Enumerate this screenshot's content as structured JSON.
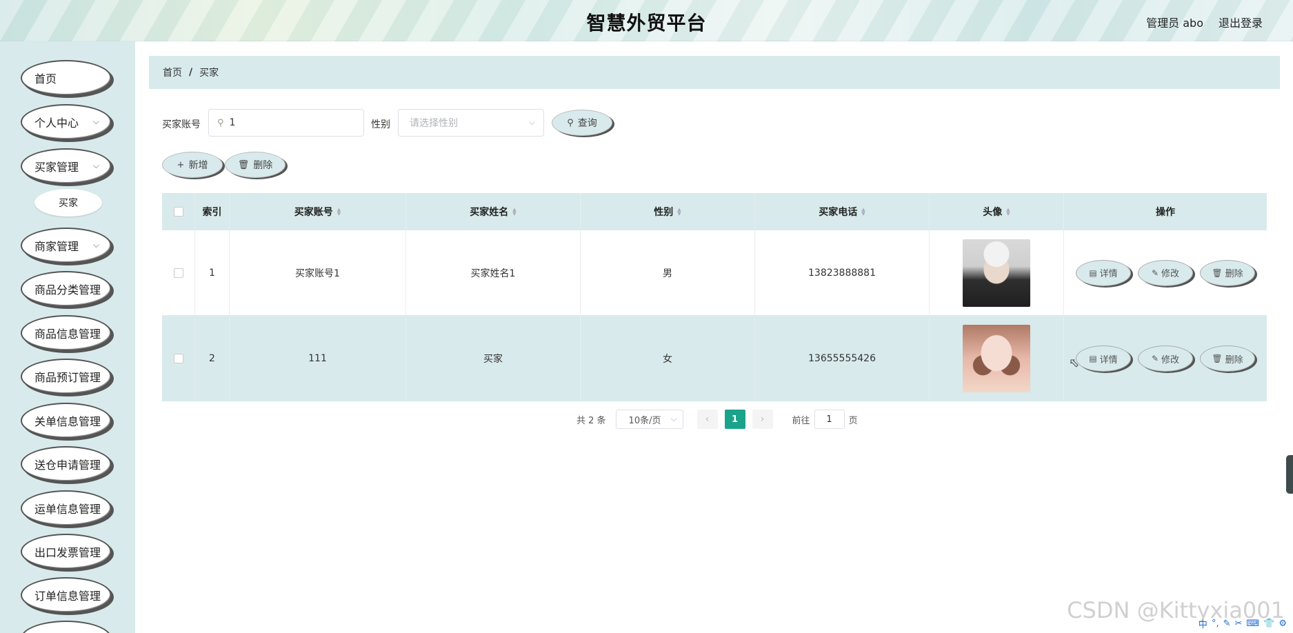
{
  "header": {
    "title": "智慧外贸平台",
    "user": "管理员 abo",
    "logout": "退出登录"
  },
  "sidebar": {
    "items": [
      {
        "label": "首页",
        "chevron": false
      },
      {
        "label": "个人中心",
        "chevron": true
      },
      {
        "label": "买家管理",
        "chevron": true
      },
      {
        "label": "商家管理",
        "chevron": true
      },
      {
        "label": "商品分类管理",
        "chevron": false
      },
      {
        "label": "商品信息管理",
        "chevron": false
      },
      {
        "label": "商品预订管理",
        "chevron": false
      },
      {
        "label": "关单信息管理",
        "chevron": false
      },
      {
        "label": "送仓申请管理",
        "chevron": false
      },
      {
        "label": "运单信息管理",
        "chevron": false
      },
      {
        "label": "出口发票管理",
        "chevron": false
      },
      {
        "label": "订单信息管理",
        "chevron": false
      }
    ],
    "subitem": "买家",
    "chevron_glyph": "⌵"
  },
  "breadcrumb": {
    "home": "首页",
    "separator": "/",
    "current": "买家"
  },
  "search": {
    "account_label": "买家账号",
    "account_value": "1",
    "gender_label": "性别",
    "gender_placeholder": "请选择性别",
    "query_button": "查询"
  },
  "actions": {
    "add": "新增",
    "delete": "删除"
  },
  "table": {
    "columns": [
      "索引",
      "买家账号",
      "买家姓名",
      "性别",
      "买家电话",
      "头像",
      "操作"
    ],
    "rows": [
      {
        "index": "1",
        "account": "买家账号1",
        "name": "买家姓名1",
        "gender": "男",
        "phone": "13823888881"
      },
      {
        "index": "2",
        "account": "111",
        "name": "买家",
        "gender": "女",
        "phone": "13655555426"
      }
    ],
    "row_actions": {
      "detail": "详情",
      "edit": "修改",
      "delete": "删除"
    }
  },
  "pagination": {
    "total": "共 2 条",
    "page_size": "10条/页",
    "current_page": "1",
    "goto_label": "前往",
    "goto_value": "1",
    "page_suffix": "页"
  },
  "watermark": "CSDN @Kittyxia001",
  "ime_bar": [
    "中",
    "°,",
    "✎",
    "✂",
    "⌨",
    "👕",
    "⚙"
  ],
  "colors": {
    "accent": "#1aa38a",
    "panel": "#d8eaec"
  }
}
